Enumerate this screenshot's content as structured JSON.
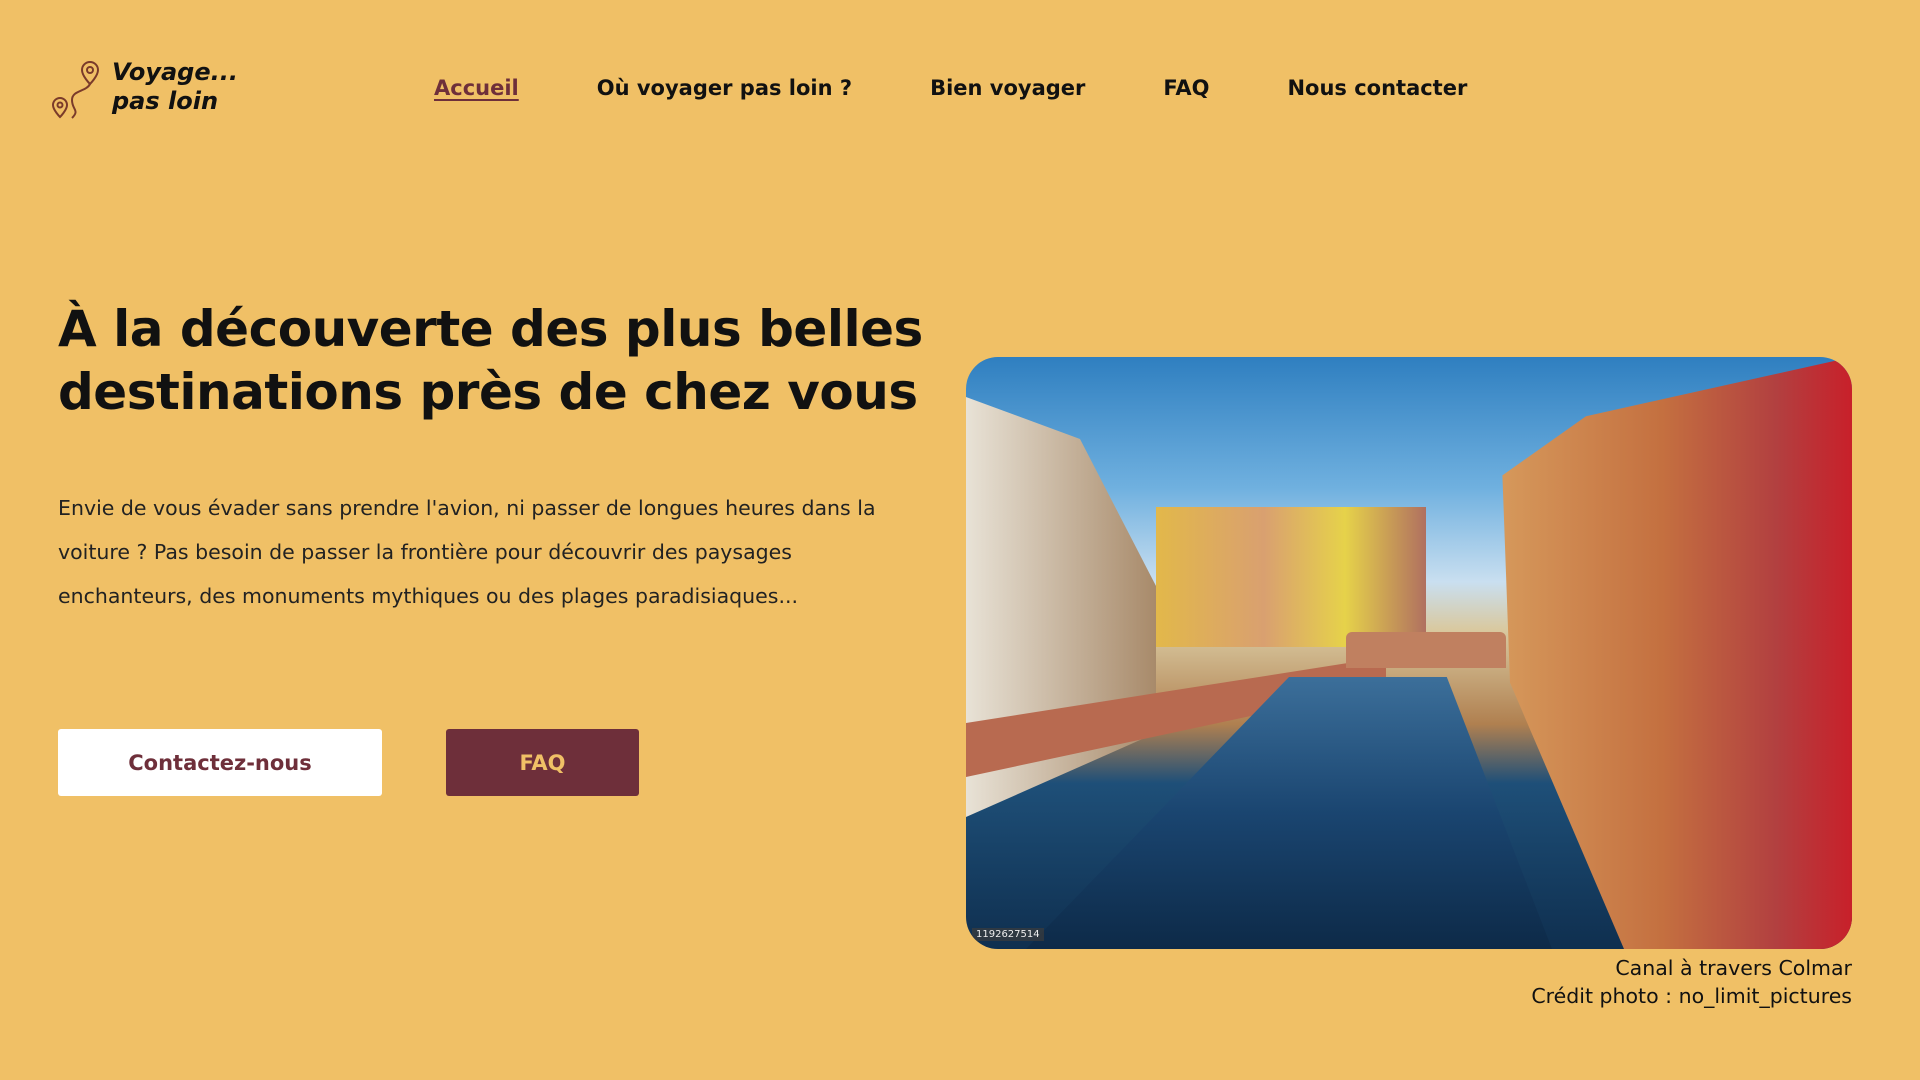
{
  "logo": {
    "line1": "Voyage...",
    "line2": "pas loin",
    "icon": "map-route-pin-icon"
  },
  "nav": {
    "items": [
      {
        "label": "Accueil",
        "active": true
      },
      {
        "label": "Où voyager pas loin ?"
      },
      {
        "label": "Bien voyager"
      },
      {
        "label": "FAQ"
      },
      {
        "label": "Nous contacter"
      }
    ]
  },
  "hero": {
    "title": "À la découverte des plus belles destinations près de chez vous",
    "intro": "Envie de vous évader sans prendre l'avion, ni passer de longues heures dans la voiture ? Pas besoin de passer la frontière pour découvrir des paysages enchanteurs, des monuments mythiques ou des plages paradisiaques...",
    "contact_button": "Contactez-nous",
    "faq_button": "FAQ"
  },
  "photo": {
    "stock_id": "1192627514",
    "caption": "Canal à travers Colmar",
    "credit": "Crédit photo : no_limit_pictures"
  },
  "colors": {
    "background": "#f0c066",
    "accent": "#6e2f3a",
    "button_light": "#ffffff"
  }
}
